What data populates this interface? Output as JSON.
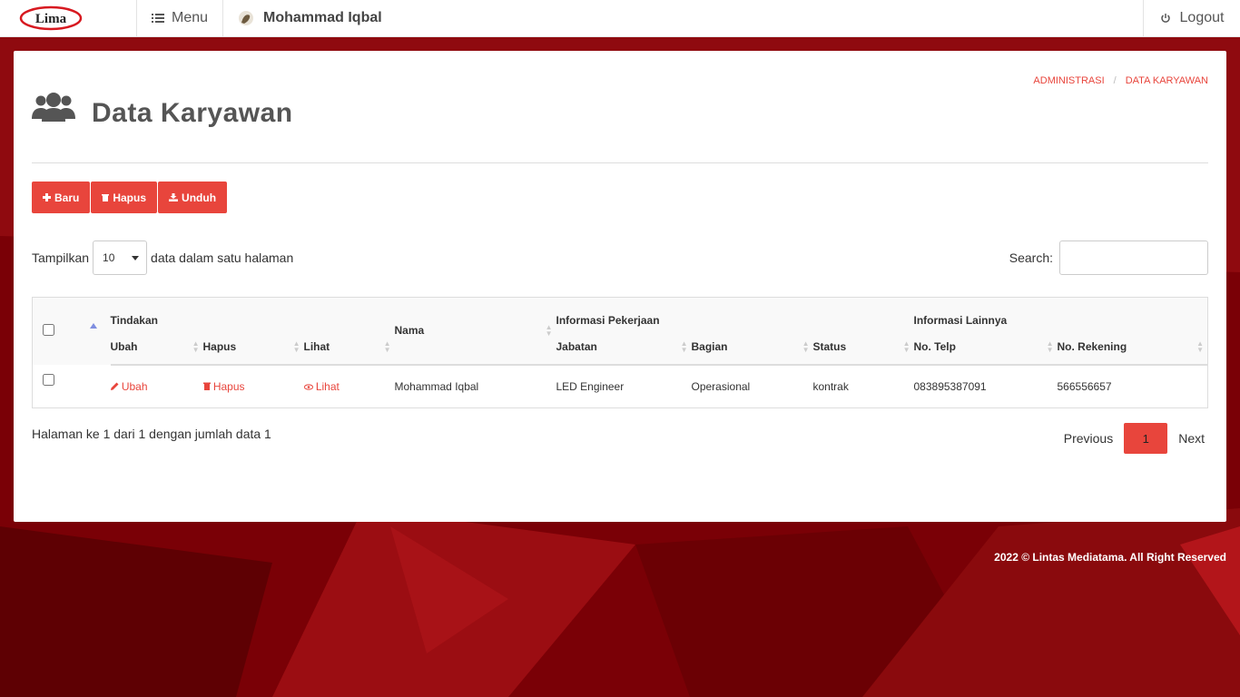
{
  "brand": {
    "logo_text": "Lima"
  },
  "topbar": {
    "menu_label": "Menu",
    "user_name": "Mohammad Iqbal",
    "logout_label": "Logout"
  },
  "breadcrumb": [
    "ADMINISTRASI",
    "DATA KARYAWAN"
  ],
  "page_title": "Data Karyawan",
  "toolbar": {
    "new_label": "Baru",
    "delete_label": "Hapus",
    "download_label": "Unduh"
  },
  "length": {
    "prefix": "Tampilkan",
    "value": "10",
    "suffix": "data dalam satu halaman"
  },
  "search": {
    "label": "Search:",
    "value": ""
  },
  "table": {
    "group_headers": {
      "actions": "Tindakan",
      "name": "Nama",
      "job": "Informasi Pekerjaan",
      "other": "Informasi Lainnya"
    },
    "columns": [
      "Ubah",
      "Hapus",
      "Lihat",
      "Jabatan",
      "Bagian",
      "Status",
      "No. Telp",
      "No. Rekening"
    ],
    "rows": [
      {
        "edit": "Ubah",
        "delete": "Hapus",
        "view": "Lihat",
        "name": "Mohammad Iqbal",
        "jabatan": "LED Engineer",
        "bagian": "Operasional",
        "status": "kontrak",
        "telp": "083895387091",
        "rekening": "566556657"
      }
    ]
  },
  "info": "Halaman ke 1 dari 1 dengan jumlah data 1",
  "pagination": {
    "previous": "Previous",
    "current": "1",
    "next": "Next"
  },
  "footer": "2022 © Lintas Mediatama. All Right Reserved",
  "colors": {
    "accent": "#e8453c",
    "background": "#7d0008"
  }
}
